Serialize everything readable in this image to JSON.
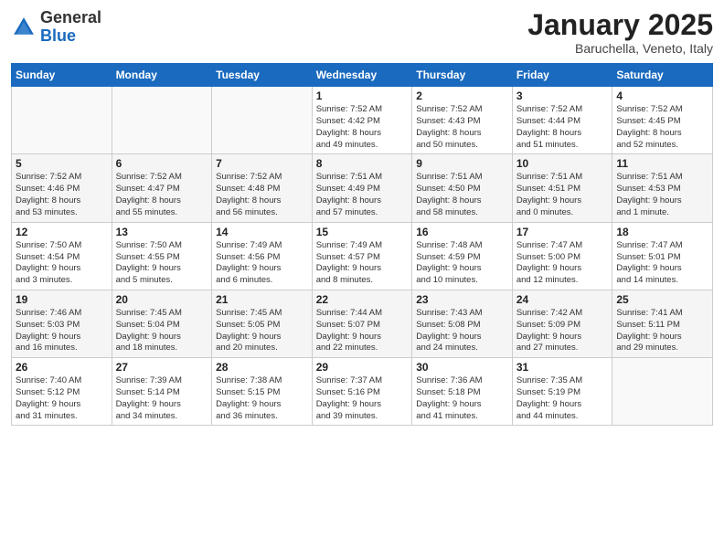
{
  "header": {
    "logo_general": "General",
    "logo_blue": "Blue",
    "month": "January 2025",
    "location": "Baruchella, Veneto, Italy"
  },
  "weekdays": [
    "Sunday",
    "Monday",
    "Tuesday",
    "Wednesday",
    "Thursday",
    "Friday",
    "Saturday"
  ],
  "weeks": [
    [
      {
        "day": "",
        "info": ""
      },
      {
        "day": "",
        "info": ""
      },
      {
        "day": "",
        "info": ""
      },
      {
        "day": "1",
        "info": "Sunrise: 7:52 AM\nSunset: 4:42 PM\nDaylight: 8 hours\nand 49 minutes."
      },
      {
        "day": "2",
        "info": "Sunrise: 7:52 AM\nSunset: 4:43 PM\nDaylight: 8 hours\nand 50 minutes."
      },
      {
        "day": "3",
        "info": "Sunrise: 7:52 AM\nSunset: 4:44 PM\nDaylight: 8 hours\nand 51 minutes."
      },
      {
        "day": "4",
        "info": "Sunrise: 7:52 AM\nSunset: 4:45 PM\nDaylight: 8 hours\nand 52 minutes."
      }
    ],
    [
      {
        "day": "5",
        "info": "Sunrise: 7:52 AM\nSunset: 4:46 PM\nDaylight: 8 hours\nand 53 minutes."
      },
      {
        "day": "6",
        "info": "Sunrise: 7:52 AM\nSunset: 4:47 PM\nDaylight: 8 hours\nand 55 minutes."
      },
      {
        "day": "7",
        "info": "Sunrise: 7:52 AM\nSunset: 4:48 PM\nDaylight: 8 hours\nand 56 minutes."
      },
      {
        "day": "8",
        "info": "Sunrise: 7:51 AM\nSunset: 4:49 PM\nDaylight: 8 hours\nand 57 minutes."
      },
      {
        "day": "9",
        "info": "Sunrise: 7:51 AM\nSunset: 4:50 PM\nDaylight: 8 hours\nand 58 minutes."
      },
      {
        "day": "10",
        "info": "Sunrise: 7:51 AM\nSunset: 4:51 PM\nDaylight: 9 hours\nand 0 minutes."
      },
      {
        "day": "11",
        "info": "Sunrise: 7:51 AM\nSunset: 4:53 PM\nDaylight: 9 hours\nand 1 minute."
      }
    ],
    [
      {
        "day": "12",
        "info": "Sunrise: 7:50 AM\nSunset: 4:54 PM\nDaylight: 9 hours\nand 3 minutes."
      },
      {
        "day": "13",
        "info": "Sunrise: 7:50 AM\nSunset: 4:55 PM\nDaylight: 9 hours\nand 5 minutes."
      },
      {
        "day": "14",
        "info": "Sunrise: 7:49 AM\nSunset: 4:56 PM\nDaylight: 9 hours\nand 6 minutes."
      },
      {
        "day": "15",
        "info": "Sunrise: 7:49 AM\nSunset: 4:57 PM\nDaylight: 9 hours\nand 8 minutes."
      },
      {
        "day": "16",
        "info": "Sunrise: 7:48 AM\nSunset: 4:59 PM\nDaylight: 9 hours\nand 10 minutes."
      },
      {
        "day": "17",
        "info": "Sunrise: 7:47 AM\nSunset: 5:00 PM\nDaylight: 9 hours\nand 12 minutes."
      },
      {
        "day": "18",
        "info": "Sunrise: 7:47 AM\nSunset: 5:01 PM\nDaylight: 9 hours\nand 14 minutes."
      }
    ],
    [
      {
        "day": "19",
        "info": "Sunrise: 7:46 AM\nSunset: 5:03 PM\nDaylight: 9 hours\nand 16 minutes."
      },
      {
        "day": "20",
        "info": "Sunrise: 7:45 AM\nSunset: 5:04 PM\nDaylight: 9 hours\nand 18 minutes."
      },
      {
        "day": "21",
        "info": "Sunrise: 7:45 AM\nSunset: 5:05 PM\nDaylight: 9 hours\nand 20 minutes."
      },
      {
        "day": "22",
        "info": "Sunrise: 7:44 AM\nSunset: 5:07 PM\nDaylight: 9 hours\nand 22 minutes."
      },
      {
        "day": "23",
        "info": "Sunrise: 7:43 AM\nSunset: 5:08 PM\nDaylight: 9 hours\nand 24 minutes."
      },
      {
        "day": "24",
        "info": "Sunrise: 7:42 AM\nSunset: 5:09 PM\nDaylight: 9 hours\nand 27 minutes."
      },
      {
        "day": "25",
        "info": "Sunrise: 7:41 AM\nSunset: 5:11 PM\nDaylight: 9 hours\nand 29 minutes."
      }
    ],
    [
      {
        "day": "26",
        "info": "Sunrise: 7:40 AM\nSunset: 5:12 PM\nDaylight: 9 hours\nand 31 minutes."
      },
      {
        "day": "27",
        "info": "Sunrise: 7:39 AM\nSunset: 5:14 PM\nDaylight: 9 hours\nand 34 minutes."
      },
      {
        "day": "28",
        "info": "Sunrise: 7:38 AM\nSunset: 5:15 PM\nDaylight: 9 hours\nand 36 minutes."
      },
      {
        "day": "29",
        "info": "Sunrise: 7:37 AM\nSunset: 5:16 PM\nDaylight: 9 hours\nand 39 minutes."
      },
      {
        "day": "30",
        "info": "Sunrise: 7:36 AM\nSunset: 5:18 PM\nDaylight: 9 hours\nand 41 minutes."
      },
      {
        "day": "31",
        "info": "Sunrise: 7:35 AM\nSunset: 5:19 PM\nDaylight: 9 hours\nand 44 minutes."
      },
      {
        "day": "",
        "info": ""
      }
    ]
  ]
}
